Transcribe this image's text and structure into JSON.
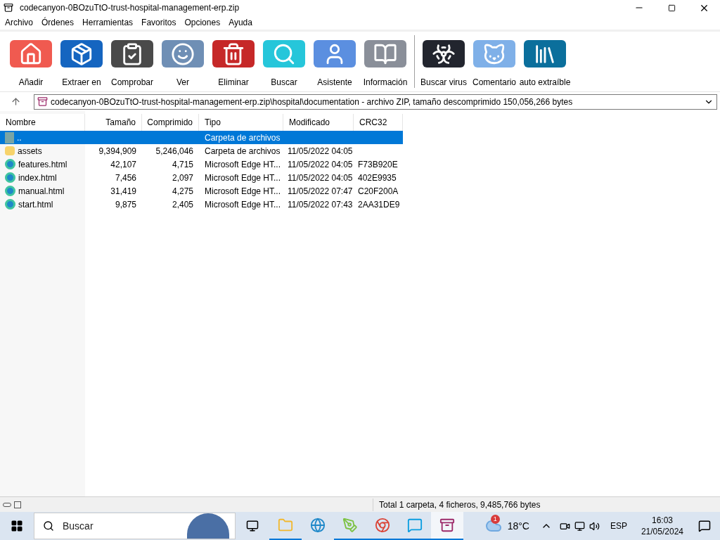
{
  "window": {
    "title": "codecanyon-0BOzuTtO-trust-hospital-management-erp.zip"
  },
  "menu": [
    "Archivo",
    "Órdenes",
    "Herramientas",
    "Favoritos",
    "Opciones",
    "Ayuda"
  ],
  "toolbar": {
    "main": [
      {
        "label": "Añadir",
        "kind": "add"
      },
      {
        "label": "Extraer en",
        "kind": "extract"
      },
      {
        "label": "Comprobar",
        "kind": "test"
      },
      {
        "label": "Ver",
        "kind": "view"
      },
      {
        "label": "Eliminar",
        "kind": "delete"
      },
      {
        "label": "Buscar",
        "kind": "find"
      },
      {
        "label": "Asistente",
        "kind": "wizard"
      },
      {
        "label": "Información",
        "kind": "info"
      }
    ],
    "extra": [
      {
        "label": "Buscar virus",
        "kind": "virus"
      },
      {
        "label": "Comentario",
        "kind": "comment"
      },
      {
        "label": "auto extraíble",
        "kind": "sfx"
      }
    ]
  },
  "address": {
    "path": "codecanyon-0BOzuTtO-trust-hospital-management-erp.zip\\hospital\\documentation - archivo ZIP, tamaño descomprimido 150,056,266 bytes"
  },
  "table": {
    "columns": [
      "Nombre",
      "Tamaño",
      "Comprimido",
      "Tipo",
      "Modificado",
      "CRC32"
    ],
    "rows": [
      {
        "kind": "parent",
        "name": "..",
        "size": "",
        "packed": "",
        "type": "Carpeta de archivos",
        "modified": "",
        "crc": "",
        "selected": true
      },
      {
        "kind": "folder",
        "name": "assets",
        "size": "9,394,909",
        "packed": "5,246,046",
        "type": "Carpeta de archivos",
        "modified": "11/05/2022 04:05",
        "crc": "",
        "selected": false
      },
      {
        "kind": "html",
        "name": "features.html",
        "size": "42,107",
        "packed": "4,715",
        "type": "Microsoft Edge HT...",
        "modified": "11/05/2022 04:05",
        "crc": "F73B920E",
        "selected": false
      },
      {
        "kind": "html",
        "name": "index.html",
        "size": "7,456",
        "packed": "2,097",
        "type": "Microsoft Edge HT...",
        "modified": "11/05/2022 04:05",
        "crc": "402E9935",
        "selected": false
      },
      {
        "kind": "html",
        "name": "manual.html",
        "size": "31,419",
        "packed": "4,275",
        "type": "Microsoft Edge HT...",
        "modified": "11/05/2022 07:47",
        "crc": "C20F200A",
        "selected": false
      },
      {
        "kind": "html",
        "name": "start.html",
        "size": "9,875",
        "packed": "2,405",
        "type": "Microsoft Edge HT...",
        "modified": "11/05/2022 07:43",
        "crc": "2AA31DE9",
        "selected": false
      }
    ]
  },
  "status_bar": {
    "text": "Total 1 carpeta, 4 ficheros, 9,485,766 bytes"
  },
  "taskbar": {
    "search": {
      "placeholder": "Buscar"
    },
    "apps": [
      {
        "kind": "explorer",
        "running": true,
        "selected": false
      },
      {
        "kind": "edge",
        "running": false,
        "selected": false
      },
      {
        "kind": "pen",
        "running": true,
        "selected": false
      },
      {
        "kind": "chrome",
        "running": true,
        "selected": false
      },
      {
        "kind": "skype",
        "running": true,
        "selected": false
      },
      {
        "kind": "winrar",
        "running": true,
        "selected": true
      }
    ],
    "weather": {
      "badge": "1",
      "temp": "18°C"
    },
    "language": "ESP",
    "time": "16:03",
    "date": "21/05/2024"
  }
}
